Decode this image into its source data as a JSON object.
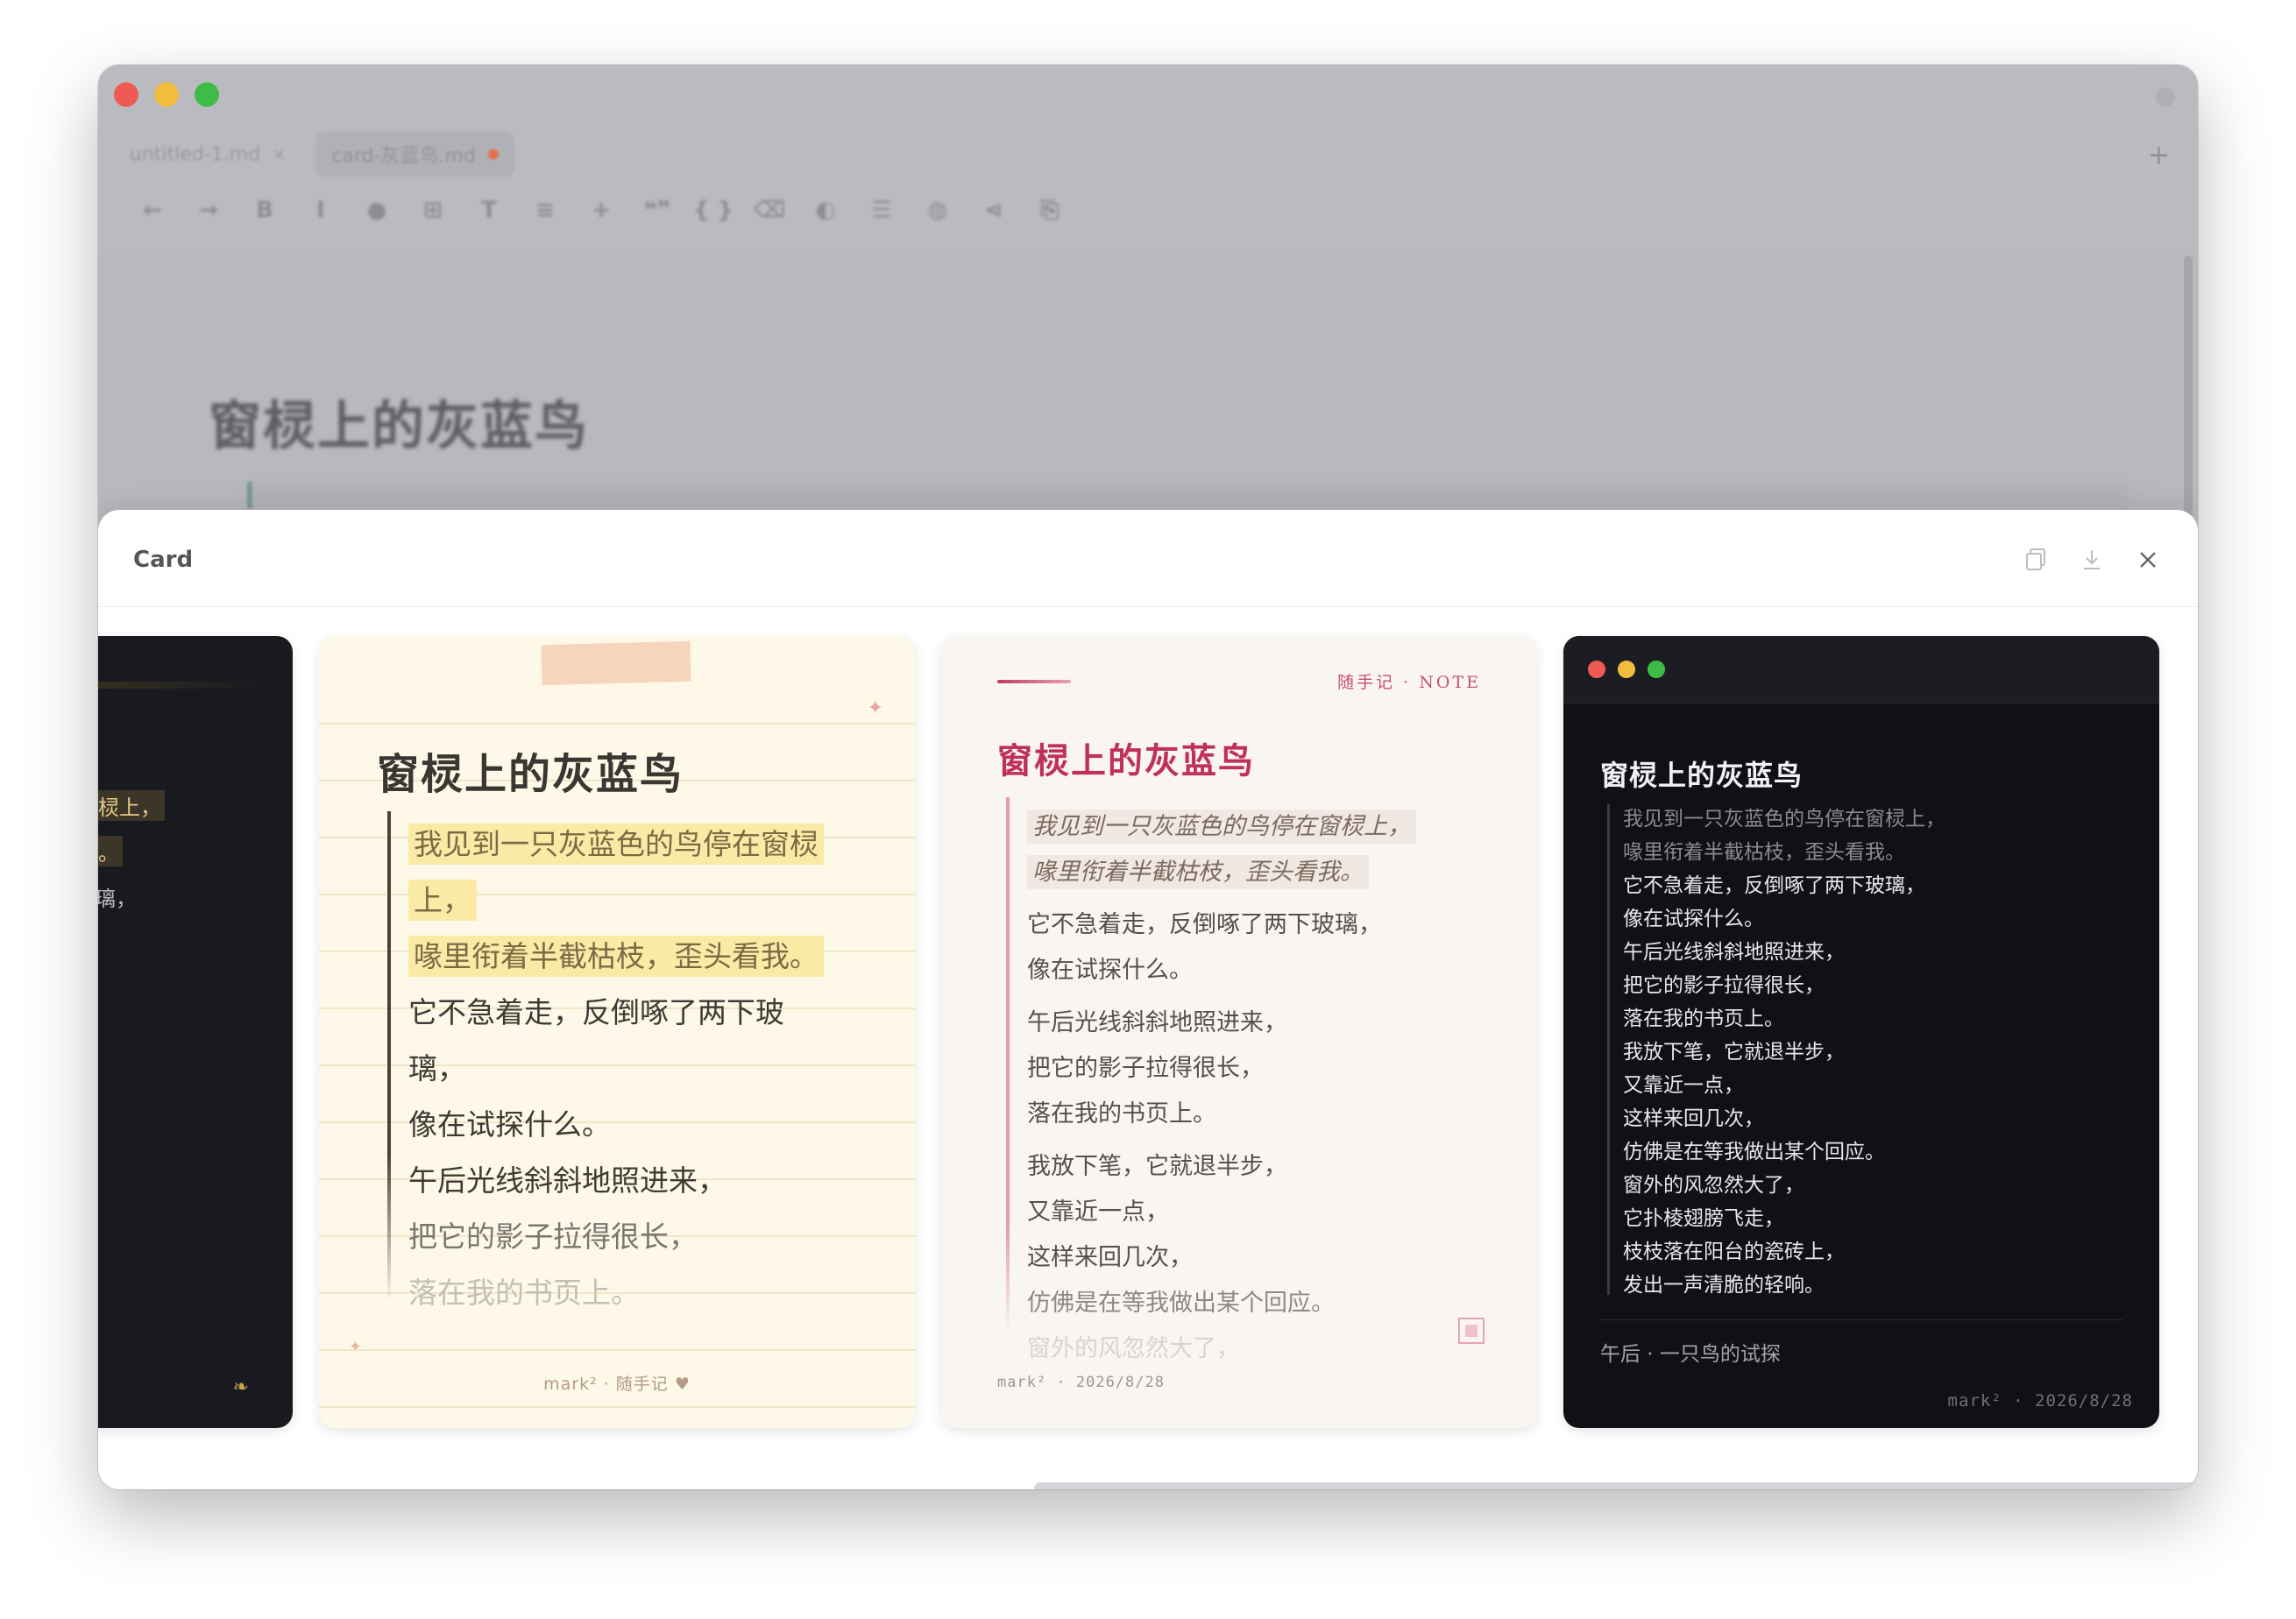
{
  "window": {
    "tabs": [
      {
        "label": "untitled-1.md",
        "close": "×"
      },
      {
        "label": "card-灰蓝鸟.md"
      }
    ],
    "add_tab": "+"
  },
  "toolbar": {
    "buttons": [
      "←",
      "→",
      "B",
      "I",
      "●",
      "⊞",
      "T",
      "≡",
      "+",
      "❝❞",
      "{ }",
      "⌫",
      "◐",
      "☰",
      "◍",
      "⋖",
      "⎘"
    ]
  },
  "document": {
    "title": "窗棂上的灰蓝鸟"
  },
  "dialog": {
    "title": "Card",
    "actions": {
      "copy": "copy",
      "download": "download",
      "close": "close"
    }
  },
  "cards": {
    "card1": {
      "lines": [
        "棂上，",
        "。",
        "璃，"
      ],
      "ornament": "❧"
    },
    "card2": {
      "title": "窗棂上的灰蓝鸟",
      "lines": [
        "我见到一只灰蓝色的鸟停在窗棂",
        "上，",
        "喙里衔着半截枯枝，歪头看我。",
        "它不急着走，反倒啄了两下玻",
        "璃，",
        "像在试探什么。",
        "午后光线斜斜地照进来，",
        "把它的影子拉得很长，",
        "落在我的书页上。"
      ],
      "footer": "mark² · 随手记 ♥",
      "star": "✦"
    },
    "card3": {
      "kicker": "随手记 · NOTE",
      "title": "窗棂上的灰蓝鸟",
      "quote": [
        "我见到一只灰蓝色的鸟停在窗棂上，",
        "喙里衔着半截枯枝，歪头看我。"
      ],
      "lines": [
        "它不急着走，反倒啄了两下玻璃，",
        "像在试探什么。",
        "午后光线斜斜地照进来，",
        "把它的影子拉得很长，",
        "落在我的书页上。",
        "我放下笔，它就退半步，",
        "又靠近一点，",
        "这样来回几次，",
        "仿佛是在等我做出某个回应。",
        "窗外的风忽然大了，"
      ],
      "footer": "mark² · 2026/8/28"
    },
    "card4": {
      "title": "窗棂上的灰蓝鸟",
      "lines_dim": [
        "我见到一只灰蓝色的鸟停在窗棂上，",
        "喙里衔着半截枯枝，歪头看我。"
      ],
      "lines": [
        "它不急着走，反倒啄了两下玻璃，",
        "像在试探什么。",
        "午后光线斜斜地照进来，",
        "把它的影子拉得很长，",
        "落在我的书页上。",
        "我放下笔，它就退半步，",
        "又靠近一点，",
        "这样来回几次，",
        "仿佛是在等我做出某个回应。",
        "窗外的风忽然大了，",
        "它扑棱翅膀飞走，",
        "枝枝落在阳台的瓷砖上，",
        "发出一声清脆的轻响。"
      ],
      "subtitle": "午后 · 一只鸟的试探",
      "footer": "mark² · 2026/8/28"
    }
  }
}
